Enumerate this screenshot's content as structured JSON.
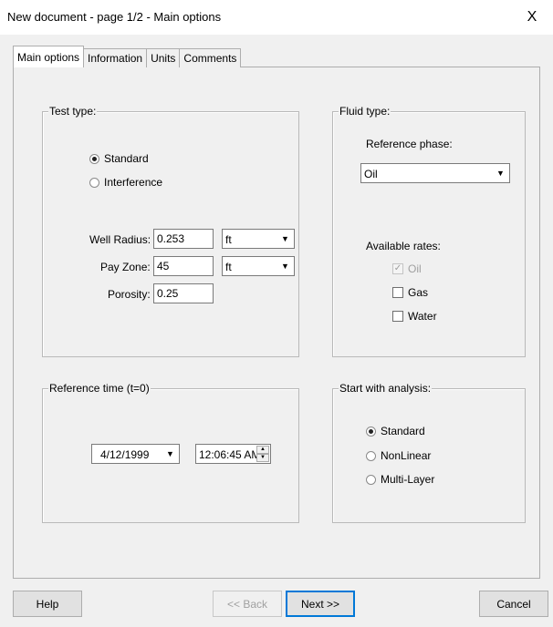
{
  "window": {
    "title": "New document - page 1/2 - Main options",
    "close_glyph": "X"
  },
  "tabs": [
    {
      "label": "Main options",
      "active": true
    },
    {
      "label": "Information",
      "active": false
    },
    {
      "label": "Units",
      "active": false
    },
    {
      "label": "Comments",
      "active": false
    }
  ],
  "test_type": {
    "legend": "Test type:",
    "options": [
      {
        "label": "Standard",
        "checked": true
      },
      {
        "label": "Interference",
        "checked": false
      }
    ],
    "well_radius": {
      "label": "Well Radius:",
      "value": "0.253",
      "unit": "ft"
    },
    "pay_zone": {
      "label": "Pay Zone:",
      "value": "45",
      "unit": "ft"
    },
    "porosity": {
      "label": "Porosity:",
      "value": "0.25"
    }
  },
  "fluid_type": {
    "legend": "Fluid type:",
    "reference_phase_label": "Reference phase:",
    "reference_phase_value": "Oil",
    "available_rates_label": "Available rates:",
    "rates": [
      {
        "label": "Oil",
        "checked": true,
        "disabled": true
      },
      {
        "label": "Gas",
        "checked": false,
        "disabled": false
      },
      {
        "label": "Water",
        "checked": false,
        "disabled": false
      }
    ]
  },
  "reference_time": {
    "legend": "Reference time (t=0)",
    "date": "4/12/1999",
    "time": "12:06:45 AM"
  },
  "start_analysis": {
    "legend": "Start with analysis:",
    "options": [
      {
        "label": "Standard",
        "checked": true
      },
      {
        "label": "NonLinear",
        "checked": false
      },
      {
        "label": "Multi-Layer",
        "checked": false
      }
    ]
  },
  "buttons": {
    "help": "Help",
    "back": "<< Back",
    "next": "Next >>",
    "cancel": "Cancel"
  },
  "icons": {
    "dropdown": "chevron-down-icon",
    "spin_up": "spin-up-icon",
    "spin_down": "spin-down-icon",
    "close": "close-icon"
  }
}
